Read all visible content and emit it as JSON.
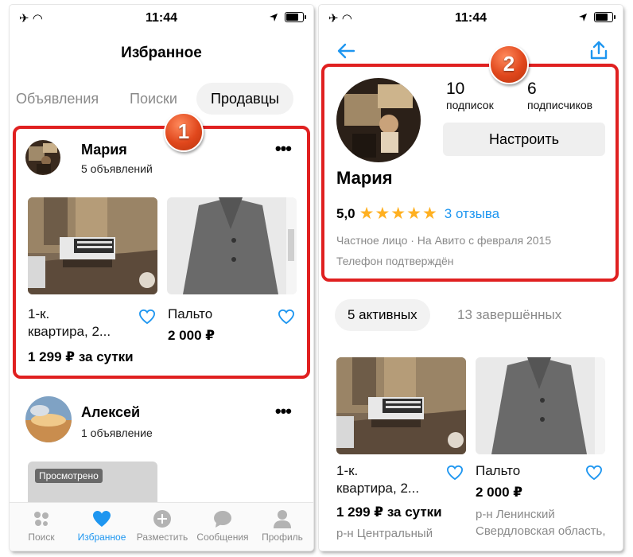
{
  "left": {
    "status": {
      "time": "11:44"
    },
    "title": "Избранное",
    "tabs": [
      {
        "label": "Объявления"
      },
      {
        "label": "Поиски"
      },
      {
        "label": "Продавцы"
      }
    ],
    "badge": "1",
    "sellers": [
      {
        "name": "Мария",
        "listings_count": "5 объявлений",
        "items": [
          {
            "title_line1": "1-к.",
            "title_line2": "квартира, 2...",
            "price": "1 299 ₽ за сутки"
          },
          {
            "title_line1": "Пальто",
            "title_line2": "",
            "price": "2 000 ₽"
          }
        ]
      },
      {
        "name": "Алексей",
        "listings_count": "1 объявление",
        "viewed_label": "Просмотрено"
      }
    ],
    "nav": [
      {
        "label": "Поиск"
      },
      {
        "label": "Избранное"
      },
      {
        "label": "Разместить"
      },
      {
        "label": "Сообщения"
      },
      {
        "label": "Профиль"
      }
    ]
  },
  "right": {
    "status": {
      "time": "11:44"
    },
    "badge": "2",
    "profile": {
      "subscriptions_count": "10",
      "subscriptions_label": "подписок",
      "subscribers_count": "6",
      "subscribers_label": "подписчиков",
      "configure_label": "Настроить",
      "name": "Мария",
      "rating": "5,0",
      "reviews": "3 отзыва",
      "since": "Частное лицо · На Авито с февраля 2015",
      "phone_verified": "Телефон подтверждён"
    },
    "filters": {
      "active": "5 активных",
      "completed": "13 завершённых"
    },
    "items": [
      {
        "title_line1": "1-к.",
        "title_line2": "квартира, 2...",
        "price": "1 299 ₽ за сутки",
        "location": "р-н Центральный"
      },
      {
        "title_line1": "Пальто",
        "title_line2": "",
        "price": "2 000 ₽",
        "location_line1": "р-н Ленинский",
        "location_line2": "Свердловская область,"
      }
    ]
  },
  "colors": {
    "accent": "#1e96f0",
    "annotation": "#e02020",
    "star": "#ffb020"
  }
}
